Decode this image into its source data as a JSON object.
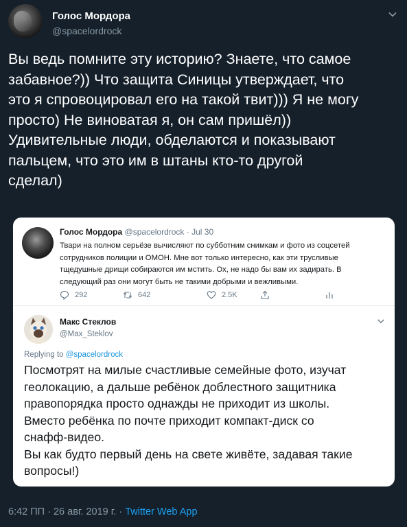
{
  "tweet": {
    "author_name": "Голос Мордора",
    "author_handle": "@spacelordrock",
    "text": "Вы ведь помните эту историю? Знаете, что самое\nзабавное?)) Что защита Синицы утверждает, что\nэто я спровоцировал его на такой твит))) Я не могу\nпросто) Не виноватая я, он сам пришёл))\nУдивительные люди, обделаются и показывают\nпальцем, что это им в штаны кто-то другой\nсделал)",
    "footer_meta": "6:42 ПП · 26 авг. 2019 г. · ",
    "footer_source": "Twitter Web App"
  },
  "quoted": {
    "original": {
      "name": "Голос Мордора",
      "meta": "@spacelordrock · Jul 30",
      "text": "Твари на полном серьёзе вычисляют по субботним снимкам и фото из соцсетей сотрудников полиции и ОМОН. Мне вот только интересно, как эти трусливые тщедушные дрищи собираются им мстить. Ох, не надо бы вам их задирать. В следующий раз они могут быть не такими добрыми и вежливыми.",
      "replies": "292",
      "retweets": "642",
      "likes": "2.5K"
    },
    "reply": {
      "name": "Макс Стеклов",
      "handle": "@Max_Steklov",
      "replying_prefix": "Replying to ",
      "replying_to": "@spacelordrock",
      "text": "Посмотрят на милые счастливые семейные фото, изучат\nгеолокацию, а дальше ребёнок доблестного защитника\nправопорядка просто однажды не приходит из школы.\nВместо ребёнка по почте приходит компакт-диск со\nснафф-видео.\nВы как будто первый день на свете живёте, задавая такие\nвопросы!)"
    }
  },
  "icons": [
    "chevron-down-icon",
    "reply-icon",
    "retweet-icon",
    "like-icon",
    "share-icon",
    "analytics-icon"
  ],
  "colors": {
    "background": "#15202b",
    "accent": "#1da1f2",
    "muted": "#8899a6"
  }
}
